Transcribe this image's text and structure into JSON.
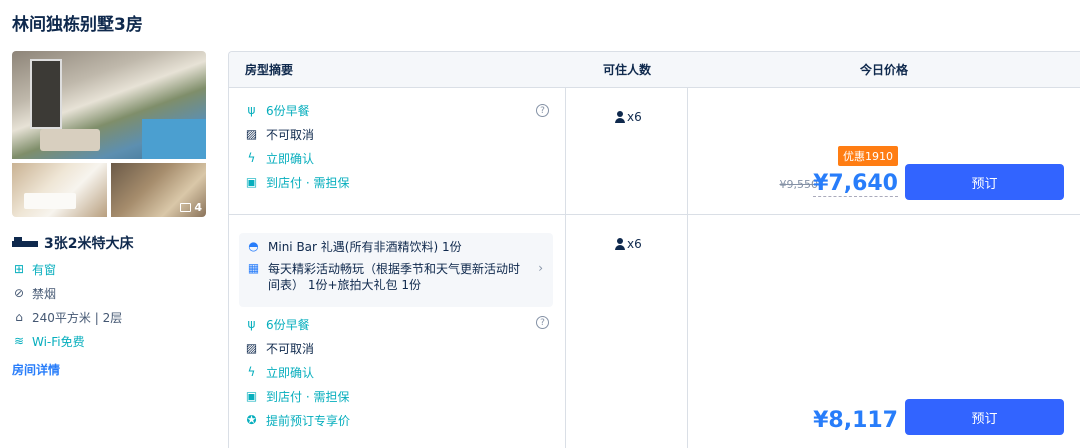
{
  "title": "林间独栋别墅3房",
  "photos": {
    "more_count": "4"
  },
  "room": {
    "bed": "3张2米特大床",
    "features": [
      {
        "icon": "window-icon",
        "label": "有窗",
        "highlight": true
      },
      {
        "icon": "no-smoking-icon",
        "label": "禁烟",
        "highlight": false
      },
      {
        "icon": "area-icon",
        "label": "240平方米 | 2层",
        "highlight": false
      },
      {
        "icon": "wifi-icon",
        "label": "Wi-Fi免费",
        "highlight": true
      }
    ],
    "detail_link": "房间详情"
  },
  "table": {
    "headers": [
      "房型摘要",
      "可住人数",
      "今日价格"
    ],
    "rows": [
      {
        "items": [
          {
            "icon": "utensils-icon",
            "label": "6份早餐",
            "green": true
          },
          {
            "icon": "no-cancel-icon",
            "label": "不可取消",
            "green": false
          },
          {
            "icon": "lightning-icon",
            "label": "立即确认",
            "green": true
          },
          {
            "icon": "pay-icon",
            "label": "到店付 · 需担保",
            "green": true
          }
        ],
        "occupancy": "x6",
        "promo": "优惠1910",
        "old_price": "¥9,550",
        "price": "¥7,640",
        "book": "预订"
      },
      {
        "gifts": [
          {
            "icon": "service-bell-icon",
            "label": "Mini Bar 礼遇(所有非酒精饮料) 1份"
          },
          {
            "icon": "gift-icon",
            "label": "每天精彩活动畅玩（根据季节和天气更新活动时间表） 1份+旅拍大礼包 1份"
          }
        ],
        "items": [
          {
            "icon": "utensils-icon",
            "label": "6份早餐",
            "green": true
          },
          {
            "icon": "no-cancel-icon",
            "label": "不可取消",
            "green": false
          },
          {
            "icon": "lightning-icon",
            "label": "立即确认",
            "green": true
          },
          {
            "icon": "pay-icon",
            "label": "到店付 · 需担保",
            "green": true
          },
          {
            "icon": "star-badge-icon",
            "label": "提前预订专享价",
            "green": true
          }
        ],
        "occupancy": "x6",
        "price": "¥8,117",
        "book": "预订"
      }
    ]
  },
  "colors": {
    "accent": "#287dfa",
    "button": "#3264ff",
    "green": "#06aebd",
    "promo": "#ff7d13"
  }
}
